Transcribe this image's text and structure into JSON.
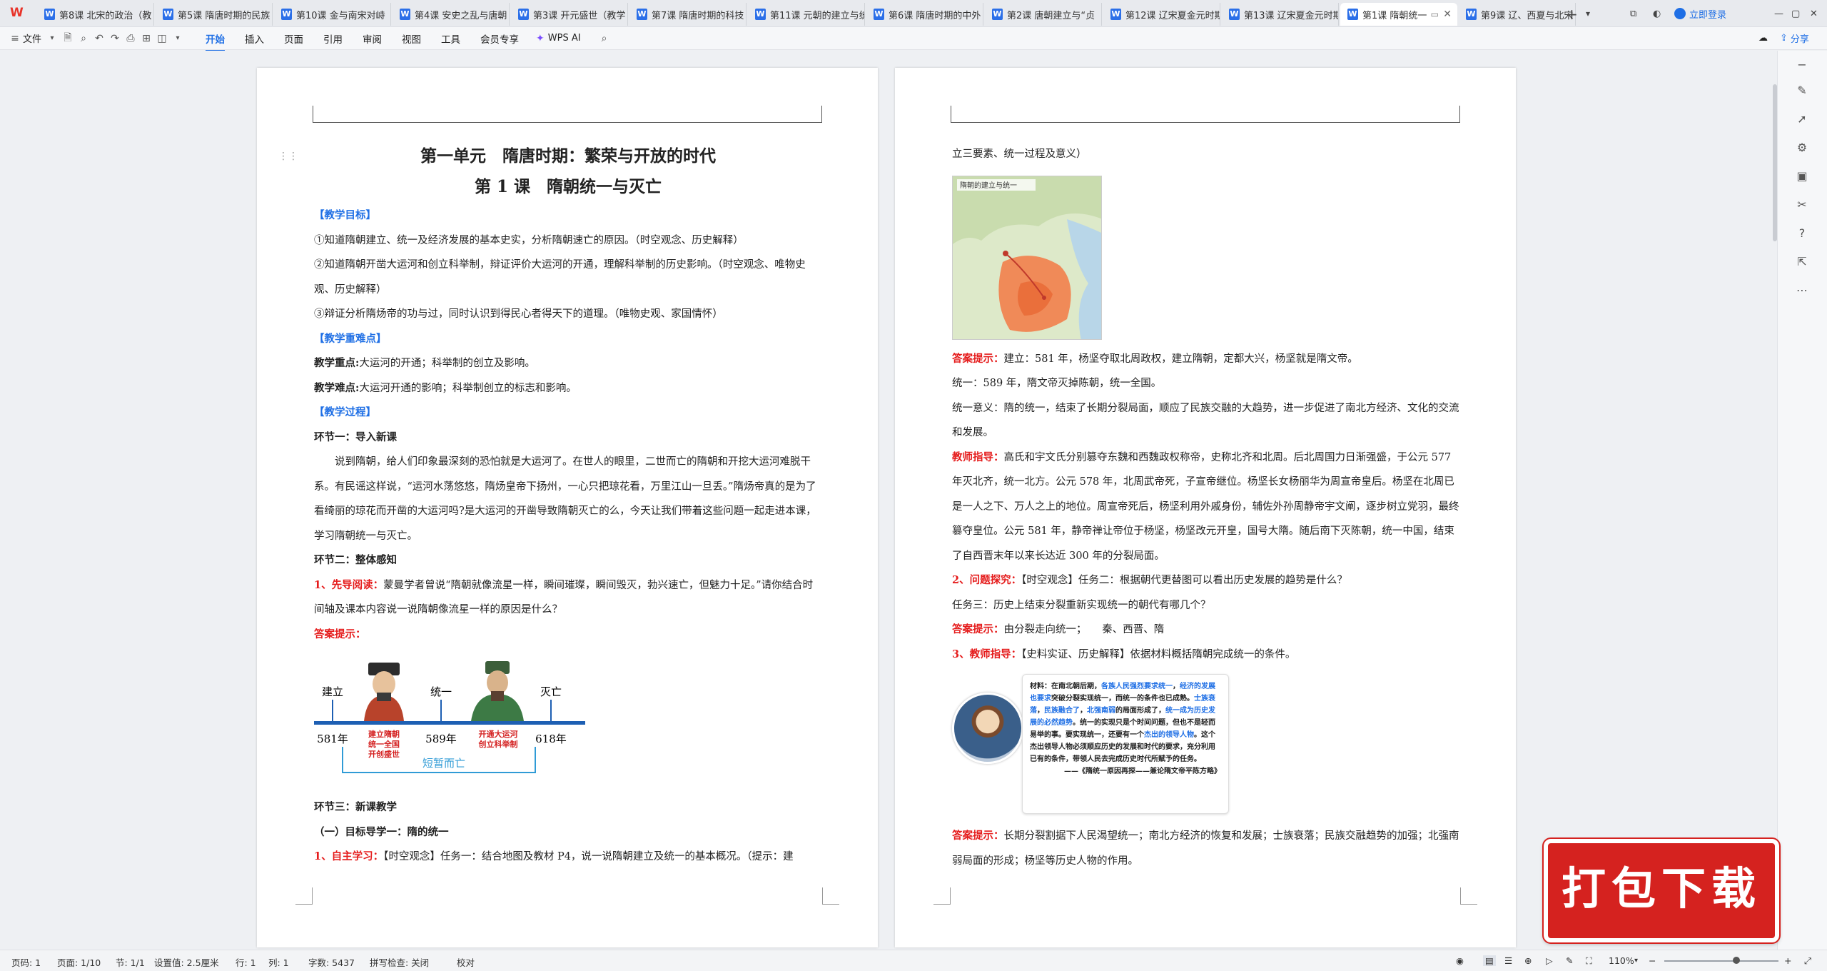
{
  "app": {
    "logo": "W"
  },
  "tabs": [
    {
      "label": "第8课 北宋的政治（教"
    },
    {
      "label": "第5课 隋唐时期的民族"
    },
    {
      "label": "第10课 金与南宋对峙"
    },
    {
      "label": "第4课 安史之乱与唐朝"
    },
    {
      "label": "第3课 开元盛世（教学"
    },
    {
      "label": "第7课 隋唐时期的科技"
    },
    {
      "label": "第11课 元朝的建立与统"
    },
    {
      "label": "第6课 隋唐时期的中外"
    },
    {
      "label": "第2课 唐朝建立与“贞"
    },
    {
      "label": "第12课 辽宋夏金元时期"
    },
    {
      "label": "第13课 辽宋夏金元时期"
    },
    {
      "label": "第1课 隋朝统一"
    },
    {
      "label": "第9课 辽、西夏与北宋"
    }
  ],
  "tabbar": {
    "login": "立即登录"
  },
  "toolbar": {
    "file": "文件",
    "menus": [
      "开始",
      "插入",
      "页面",
      "引用",
      "审阅",
      "视图",
      "工具",
      "会员专享"
    ],
    "wps_ai": "WPS AI",
    "share": "分享"
  },
  "page1": {
    "unit_title": "第一单元　隋唐时期：繁荣与开放的时代",
    "lesson_title": "第 1 课　隋朝统一与灭亡",
    "goals_head": "【教学目标】",
    "goal1": "①知道隋朝建立、统一及经济发展的基本史实，分析隋朝速亡的原因。（时空观念、历史解释）",
    "goal2": "②知道隋朝开凿大运河和创立科举制，辩证评价大运河的开通，理解科举制的历史影响。（时空观念、唯物史观、历史解释）",
    "goal3": "③辩证分析隋炀帝的功与过，同时认识到得民心者得天下的道理。（唯物史观、家国情怀）",
    "key_head": "【教学重难点】",
    "key_label": "教学重点:",
    "key_text": "大运河的开通；科举制的创立及影响。",
    "diff_label": "教学难点:",
    "diff_text": "大运河开通的影响；科举制创立的标志和影响。",
    "process_head": "【教学过程】",
    "step1": "环节一：导入新课",
    "intro": "说到隋朝，给人们印象最深刻的恐怕就是大运河了。在世人的眼里，二世而亡的隋朝和开挖大运河难脱干系。有民谣这样说，“运河水荡悠悠，隋炀皇帝下扬州，一心只把琼花看，万里江山一旦丢。”隋炀帝真的是为了看绮丽的琼花而开凿的大运河吗?是大运河的开凿导致隋朝灭亡的么，今天让我们带着这些问题一起走进本课，学习隋朝统一与灭亡。",
    "step2": "环节二：整体感知",
    "read_label": "1、先导阅读：",
    "read_text": "蒙曼学者曾说“隋朝就像流星一样，瞬间璀璨，瞬间毁灭，勃兴速亡，但魅力十足。”请你结合时间轴及课本内容说一说隋朝像流星一样的原因是什么？",
    "answer_label": "答案提示：",
    "timeline": {
      "establish": "建立",
      "unify": "统一",
      "fall": "灭亡",
      "y581": "581年",
      "y589": "589年",
      "y618": "618年",
      "note1": "建立隋朝\n统一全国\n开创盛世",
      "note2": "开通大运河\n创立科举制",
      "brief": "短暂而亡"
    },
    "step3": "环节三：新课教学",
    "guide1": "（一）目标导学一：隋的统一",
    "self_label": "1、自主学习：",
    "self_text": "【时空观念】任务一：结合地图及教材 P4，说一说隋朝建立及统一的基本概况。（提示：建"
  },
  "page2": {
    "cont": "立三要素、统一过程及意义）",
    "map_title": "隋朝的建立与统一",
    "ans1_label": "答案提示：",
    "ans1_text": "建立：581 年，杨坚夺取北周政权，建立隋朝，定都大兴，杨坚就是隋文帝。",
    "ans1_b": "统一：589 年，隋文帝灭掉陈朝，统一全国。",
    "ans1_c": "统一意义：隋的统一，结束了长期分裂局面，顺应了民族交融的大趋势，进一步促进了南北方经济、文化的交流和发展。",
    "teacher_label": "教师指导：",
    "teacher_text": "高氏和宇文氏分别篡夺东魏和西魏政权称帝，史称北齐和北周。后北周国力日渐强盛，于公元 577 年灭北齐，统一北方。公元 578 年，北周武帝死，子宣帝继位。杨坚长女杨丽华为周宣帝皇后。杨坚在北周已是一人之下、万人之上的地位。周宣帝死后，杨坚利用外戚身份，辅佐外孙周静帝宇文阐，逐步树立党羽，最终篡夺皇位。公元 581 年，静帝禅让帝位于杨坚，杨坚改元开皇，国号大隋。随后南下灭陈朝，统一中国，结束了自西晋末年以来长达近 300 年的分裂局面。",
    "q_label": "2、问题探究：",
    "q_text": "【时空观念】任务二：根据朝代更替图可以看出历史发展的趋势是什么？",
    "task3": "任务三：历史上结束分裂重新实现统一的朝代有哪几个？",
    "ans2_label": "答案提示：",
    "ans2_text": "由分裂走向统一；　　秦、西晋、隋",
    "guide_label": "3、教师指导：",
    "guide_text": "【史料实证、历史解释】依据材料概括隋朝完成统一的条件。",
    "material_pre": "材料：在南北朝后期，",
    "material_b1": "各族人民强烈要求统一",
    "material_mid1": "，",
    "material_b2": "经济的发展也要求",
    "material_mid2": "突破分裂实现统一，而统一的条件也已成熟。",
    "material_b3": "士族衰落",
    "material_mid3": "，",
    "material_b4": "民族融合了",
    "material_mid4": "，",
    "material_b5": "北强南弱",
    "material_mid5": "的局面形成了，",
    "material_b6": "统一成为历史发展的必然趋势",
    "material_mid6": "。统一的实现只是个时间问题，但也不是轻而易举的事。要实现统一，还要有一个",
    "material_b7": "杰出的领导人物",
    "material_end": "。这个杰出领导人物必须顺应历史的发展和时代的要求，充分利用已有的条件，带领人民去完成历史时代所赋予的任务。",
    "material_src": "——《隋统一原因再探——兼论隋文帝平陈方略》",
    "ans3_label": "答案提示：",
    "ans3_text": "长期分裂割据下人民渴望统一；南北方经济的恢复和发展；士族衰落；民族交融趋势的加强；北强南弱局面的形成；杨坚等历史人物的作用。"
  },
  "status": {
    "page_no": "页码: 1",
    "pages": "页面: 1/10",
    "section": "节: 1/1",
    "setting": "设置值: 2.5厘米",
    "row": "行: 1",
    "col": "列: 1",
    "words": "字数: 5437",
    "spell": "拼写检查: 关闭",
    "proof": "校对",
    "zoom": "110%"
  },
  "promo": {
    "text": "打包下载"
  }
}
